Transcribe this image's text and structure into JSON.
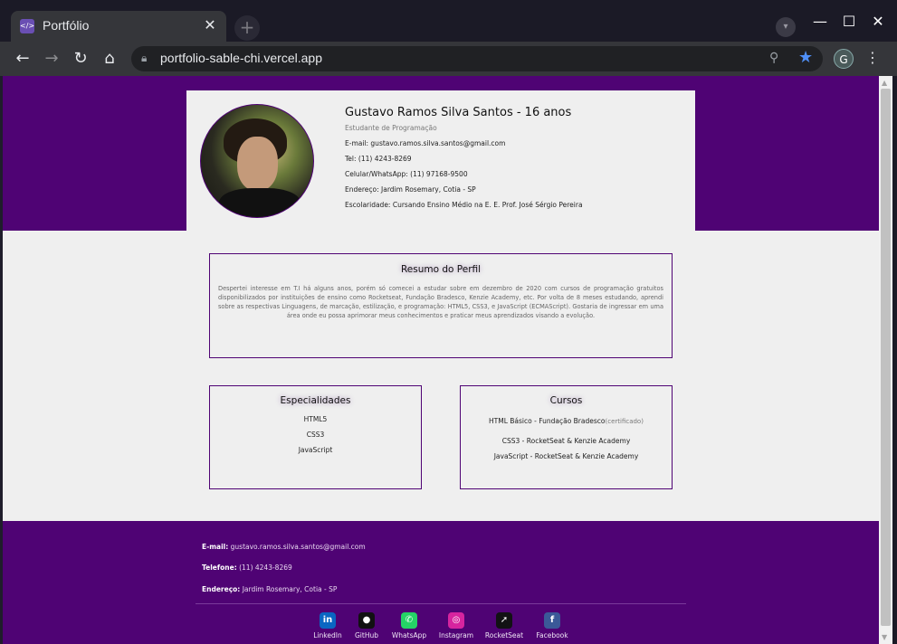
{
  "browser": {
    "tab_title": "Portfólio",
    "tab_close": "✕",
    "new_tab": "+",
    "url": "portfolio-sable-chi.vercel.app",
    "profile_initial": "G",
    "icons": [
      "back-icon",
      "forward-icon",
      "reload-icon",
      "home-icon",
      "lock-icon",
      "zoom-icon",
      "star-icon",
      "menu-icon"
    ]
  },
  "profile": {
    "name": "Gustavo Ramos Silva Santos - 16 anos",
    "role": "Estudante de Programação",
    "email": "E-mail: gustavo.ramos.silva.santos@gmail.com",
    "tel": "Tel: (11) 4243-8269",
    "cel": "Celular/WhatsApp: (11) 97168-9500",
    "address": "Endereço: Jardim Rosemary, Cotia - SP",
    "school": "Escolaridade: Cursando Ensino Médio na E. E. Prof. José Sérgio Pereira"
  },
  "summary": {
    "title": "Resumo do Perfil",
    "text": "Despertei interesse em T.I há alguns anos, porém só comecei a estudar sobre em dezembro de 2020 com cursos de programação gratuitos disponibilizados por instituições de ensino como Rocketseat, Fundação Bradesco, Kenzie Academy, etc. Por volta de 8 meses estudando, aprendi sobre as respectivas Linguagens, de marcação, estilização, e programação: HTML5, CSS3, e JavaScript (ECMAScript). Gostaria de ingressar em uma área onde eu possa aprimorar meus conhecimentos e praticar meus aprendizados visando a evolução."
  },
  "skills": {
    "title": "Especialidades",
    "items": [
      "HTML5",
      "CSS3",
      "JavaScript"
    ]
  },
  "courses": {
    "title": "Cursos",
    "item1": "HTML Básico - Fundação Bradesco",
    "item1_note": "(certificado)",
    "item2": "CSS3 - RocketSeat & Kenzie Academy",
    "item3": "JavaScript - RocketSeat & Kenzie Academy"
  },
  "footer": {
    "email_label": "E-mail:",
    "email": "gustavo.ramos.silva.santos@gmail.com",
    "phone_label": "Telefone:",
    "phone": "(11) 4243-8269",
    "address_label": "Endereço:",
    "address": "Jardim Rosemary, Cotia - SP",
    "social": [
      {
        "label": "LinkedIn",
        "icon": "linkedin-icon",
        "color": "#0a66c2",
        "glyph": "in"
      },
      {
        "label": "GitHub",
        "icon": "github-icon",
        "color": "#111111",
        "glyph": "●"
      },
      {
        "label": "WhatsApp",
        "icon": "whatsapp-icon",
        "color": "#25d366",
        "glyph": "✆"
      },
      {
        "label": "Instagram",
        "icon": "instagram-icon",
        "color": "#d6249f",
        "glyph": "◎"
      },
      {
        "label": "RocketSeat",
        "icon": "rocketseat-icon",
        "color": "#121214",
        "glyph": "➚"
      },
      {
        "label": "Facebook",
        "icon": "facebook-icon",
        "color": "#3b5998",
        "glyph": "f"
      }
    ]
  }
}
